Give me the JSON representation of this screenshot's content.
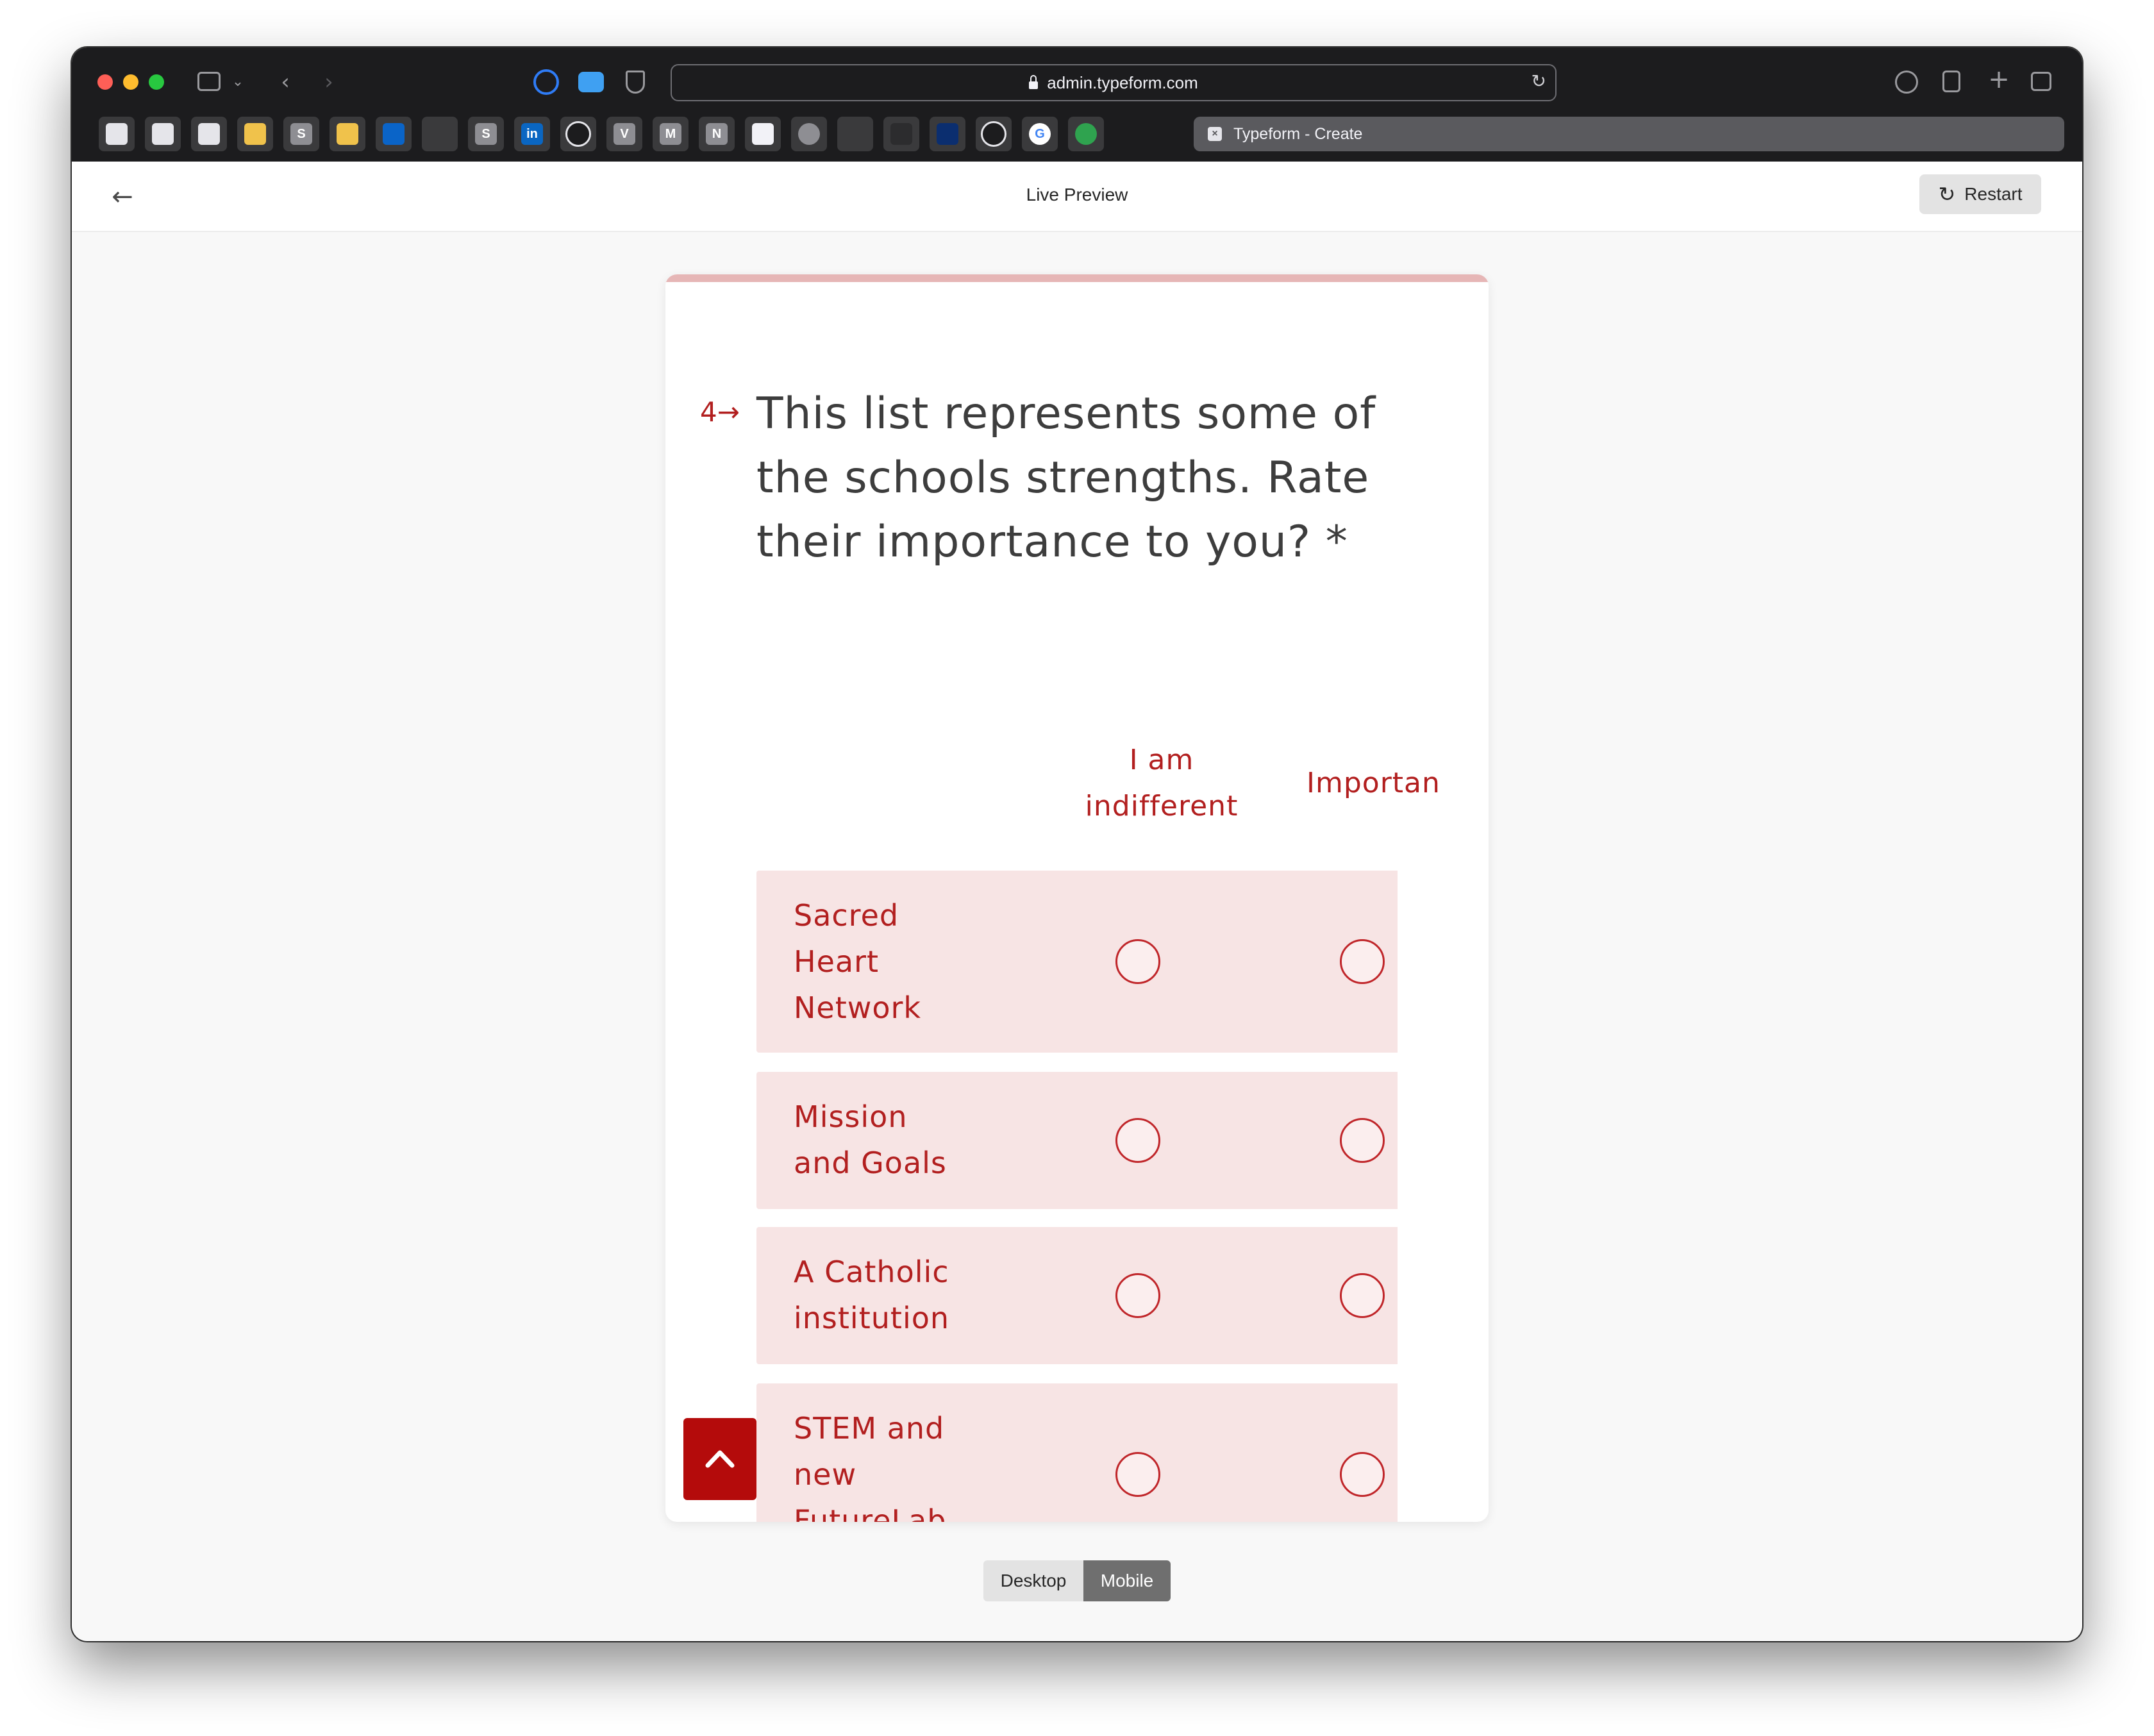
{
  "browser": {
    "url": "admin.typeform.com",
    "active_tab": "Typeform - Create",
    "bookmarks": [
      "",
      "",
      "",
      "",
      "S",
      "",
      "",
      "",
      "S",
      "in",
      "",
      "V",
      "M",
      "N",
      "",
      "",
      "",
      "",
      "",
      "",
      "G",
      ""
    ]
  },
  "header": {
    "title": "Live Preview",
    "restart_label": "Restart"
  },
  "form": {
    "question_number": "4→",
    "question": "This list represents some of the schools strengths. Rate their importance to you? *",
    "columns": [
      "I am indifferent",
      "Importan"
    ],
    "rows": [
      {
        "label": "Sacred Heart Network"
      },
      {
        "label": "Mission and Goals"
      },
      {
        "label": "A Catholic institution"
      },
      {
        "label": "STEM and new FutureLab"
      }
    ]
  },
  "view_toggle": {
    "desktop_label": "Desktop",
    "mobile_label": "Mobile",
    "selected": "Mobile"
  },
  "colors": {
    "accent": "#b21f1f",
    "row_background": "#f7e4e4",
    "card_top_bar": "#e6b6b6"
  }
}
